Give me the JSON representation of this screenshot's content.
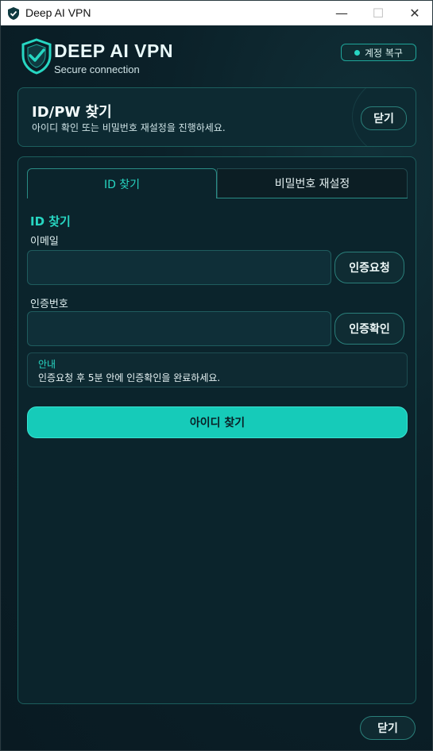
{
  "window": {
    "title": "Deep AI VPN",
    "minimize": "—",
    "maximize": "☐",
    "close": "✕"
  },
  "brand": {
    "name": "DEEP AI VPN",
    "tagline": "Secure connection"
  },
  "recover_button": {
    "label": "계정 복구"
  },
  "header": {
    "title": "ID/PW 찾기",
    "subtitle": "아이디 확인 또는 비밀번호 재설정을 진행하세요.",
    "close_label": "닫기"
  },
  "tabs": [
    {
      "label": "ID 찾기",
      "active": true
    },
    {
      "label": "비밀번호 재설정",
      "active": false
    }
  ],
  "form": {
    "section_title": "ID 찾기",
    "email_label": "이메일",
    "email_value": "",
    "request_button": "인증요청",
    "code_label": "인증번호",
    "code_value": "",
    "verify_button": "인증확인",
    "notice_title": "안내",
    "notice_text": "인증요청 후 5분 안에 인증확인을 완료하세요.",
    "submit_label": "아이디 찾기"
  },
  "footer": {
    "close_label": "닫기"
  },
  "colors": {
    "accent": "#16cbb9",
    "background": "#0b1f28",
    "border": "#1c5e5d"
  },
  "icons": [
    "shield-check-icon",
    "status-dot-icon"
  ]
}
